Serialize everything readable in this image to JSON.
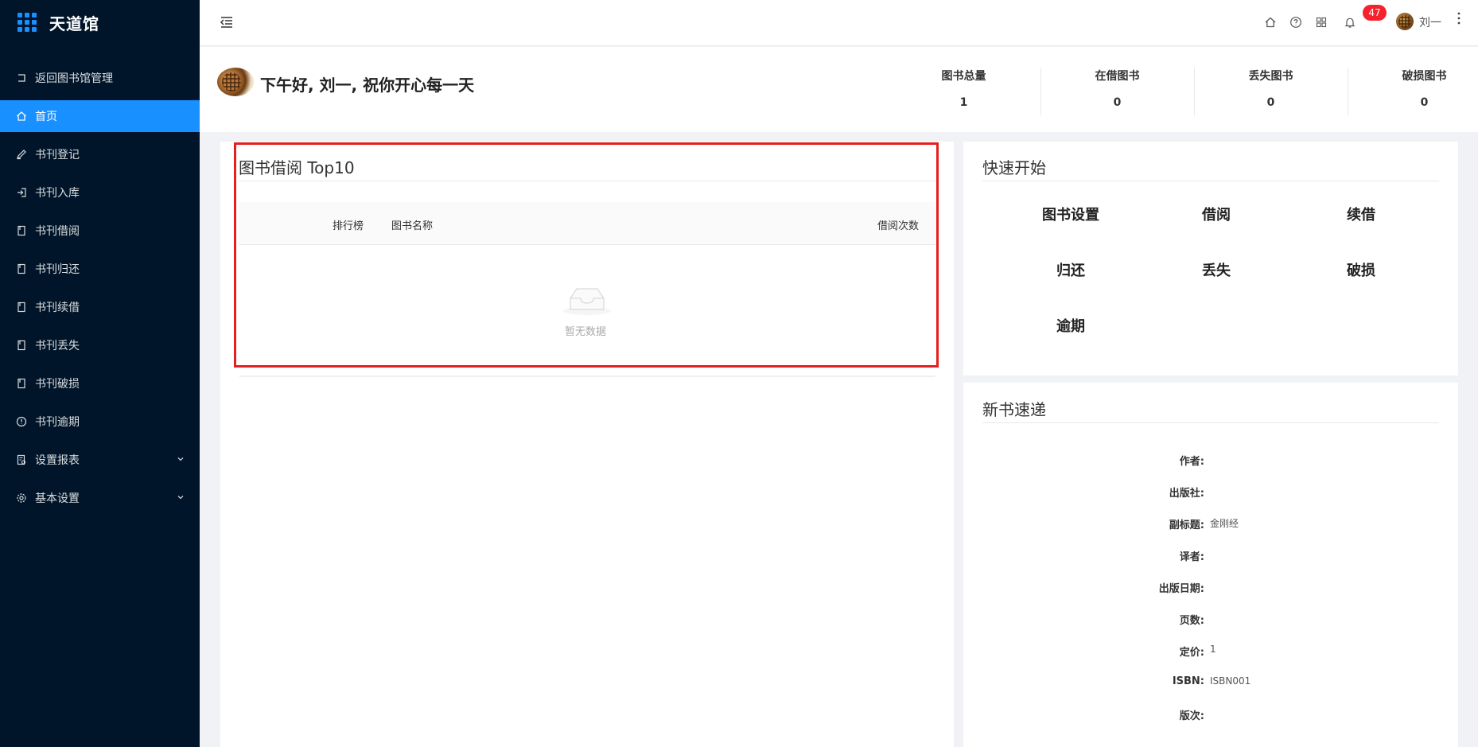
{
  "app": {
    "title": "天道馆"
  },
  "sidebar": {
    "items": [
      {
        "label": "返回图书馆管理",
        "icon": "return-icon"
      },
      {
        "label": "首页",
        "icon": "home-icon",
        "active": true
      },
      {
        "label": "书刊登记",
        "icon": "pen-icon"
      },
      {
        "label": "书刊入库",
        "icon": "import-icon"
      },
      {
        "label": "书刊借阅",
        "icon": "book-icon"
      },
      {
        "label": "书刊归还",
        "icon": "book-icon"
      },
      {
        "label": "书刊续借",
        "icon": "book-icon"
      },
      {
        "label": "书刊丢失",
        "icon": "book-icon"
      },
      {
        "label": "书刊破损",
        "icon": "book-icon"
      },
      {
        "label": "书刊逾期",
        "icon": "clock-alert-icon"
      },
      {
        "label": "设置报表",
        "icon": "report-icon",
        "expandable": true
      },
      {
        "label": "基本设置",
        "icon": "gear-icon",
        "expandable": true
      }
    ]
  },
  "header": {
    "notifications": "47",
    "username": "刘一"
  },
  "welcome": {
    "greeting": "下午好, 刘一, 祝你开心每一天",
    "stats": [
      {
        "label": "图书总量",
        "value": "1"
      },
      {
        "label": "在借图书",
        "value": "0"
      },
      {
        "label": "丢失图书",
        "value": "0"
      },
      {
        "label": "破损图书",
        "value": "0"
      }
    ]
  },
  "top10": {
    "title": "图书借阅 Top10",
    "columns": {
      "rank": "排行榜",
      "name": "图书名称",
      "count": "借阅次数"
    },
    "empty_text": "暂无数据"
  },
  "quick_start": {
    "title": "快速开始",
    "items": [
      "图书设置",
      "借阅",
      "续借",
      "归还",
      "丢失",
      "破损",
      "逾期"
    ]
  },
  "new_books": {
    "title": "新书速递",
    "fields": [
      {
        "label": "作者:",
        "value": ""
      },
      {
        "label": "出版社:",
        "value": ""
      },
      {
        "label": "副标题:",
        "value": "金刚经"
      },
      {
        "label": "译者:",
        "value": ""
      },
      {
        "label": "出版日期:",
        "value": ""
      },
      {
        "label": "页数:",
        "value": ""
      },
      {
        "label": "定价:",
        "value": "1"
      },
      {
        "label": "ISBN:",
        "value": "ISBN001"
      },
      {
        "label": "版次:",
        "value": ""
      }
    ]
  },
  "colors": {
    "sidebar_bg": "#001529",
    "accent": "#1890ff",
    "badge": "#f5222d",
    "highlight": "#e51f1f"
  }
}
